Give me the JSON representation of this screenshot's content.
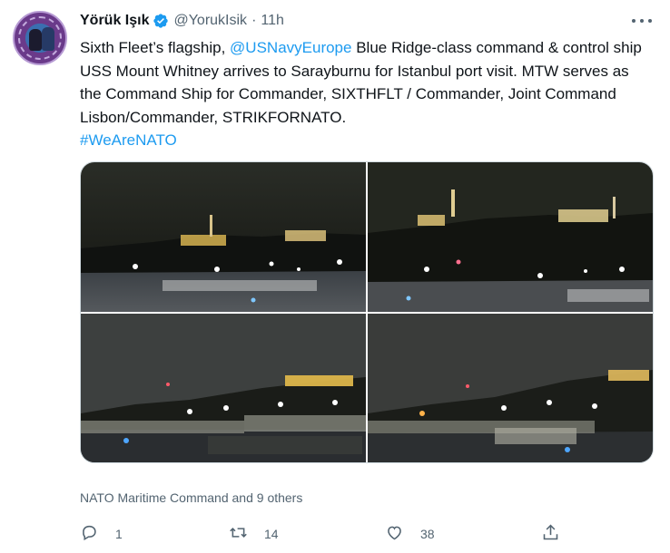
{
  "tweet": {
    "author_name": "Yörük Işık",
    "handle": "@YorukIsik",
    "separator": "·",
    "time": "11h",
    "text_part1": "Sixth Fleet’s flagship, ",
    "mention": "@USNavyEurope",
    "text_part2": " Blue Ridge-class command & control ship USS Mount Whitney arrives to Sarayburnu for Istanbul port visit. MTW serves as the Command Ship for Commander, SIXTHFLT / Commander, Joint Command Lisbon/Commander, STRIKFORNATO.",
    "hashtag": "#WeAreNATO"
  },
  "likers_text": "NATO Maritime Command and 9 others",
  "actions": {
    "reply_count": "1",
    "retweet_count": "14",
    "like_count": "38"
  },
  "colors": {
    "link": "#1d9bf0",
    "secondary_text": "#536471",
    "verified_badge": "#1d9bf0",
    "border": "#cfd9de"
  },
  "icons": [
    "verified-badge-icon",
    "more-icon",
    "reply-icon",
    "retweet-icon",
    "like-icon",
    "share-icon"
  ]
}
